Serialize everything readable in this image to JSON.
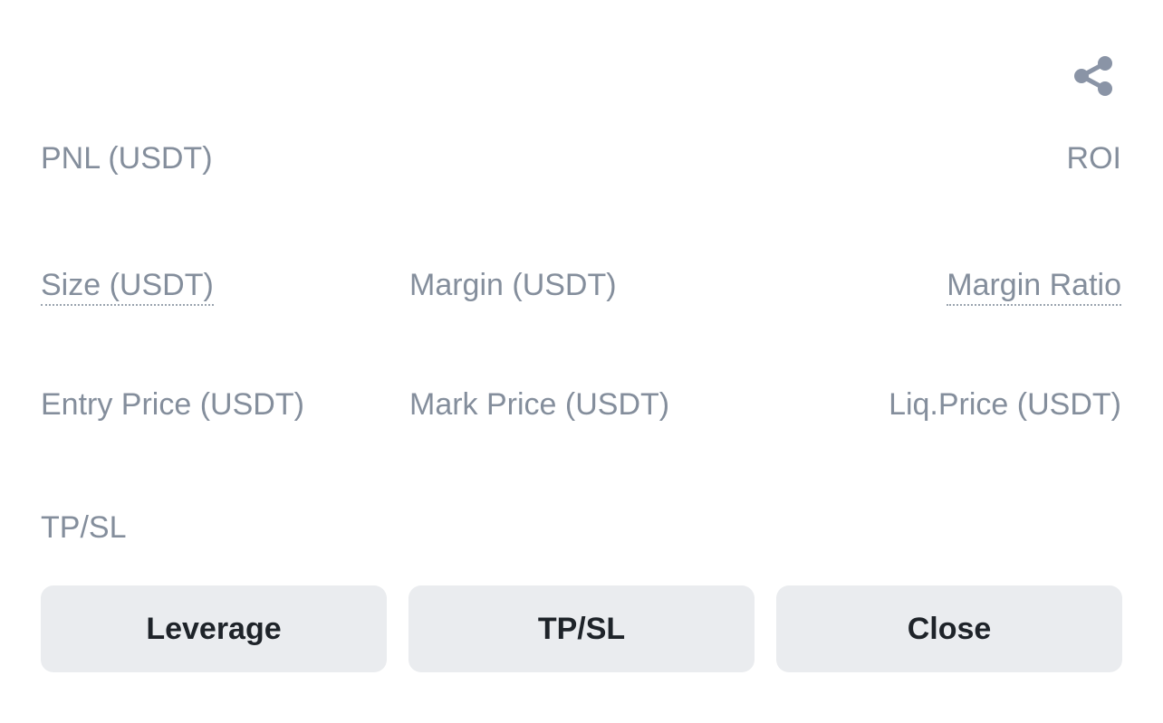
{
  "header": {
    "share_icon": "share-icon"
  },
  "summary": {
    "pnl_label": "PNL (USDT)",
    "roi_label": "ROI"
  },
  "details": {
    "size_label": "Size (USDT)",
    "margin_label": "Margin (USDT)",
    "margin_ratio_label": "Margin Ratio",
    "entry_price_label": "Entry Price (USDT)",
    "mark_price_label": "Mark Price (USDT)",
    "liq_price_label": "Liq.Price (USDT)",
    "tpsl_label": "TP/SL"
  },
  "actions": {
    "leverage_label": "Leverage",
    "tpsl_label": "TP/SL",
    "close_label": "Close"
  },
  "colors": {
    "label": "#848e9c",
    "button_bg": "#eaecef",
    "button_text": "#1e2329",
    "icon": "#8a94a6"
  }
}
